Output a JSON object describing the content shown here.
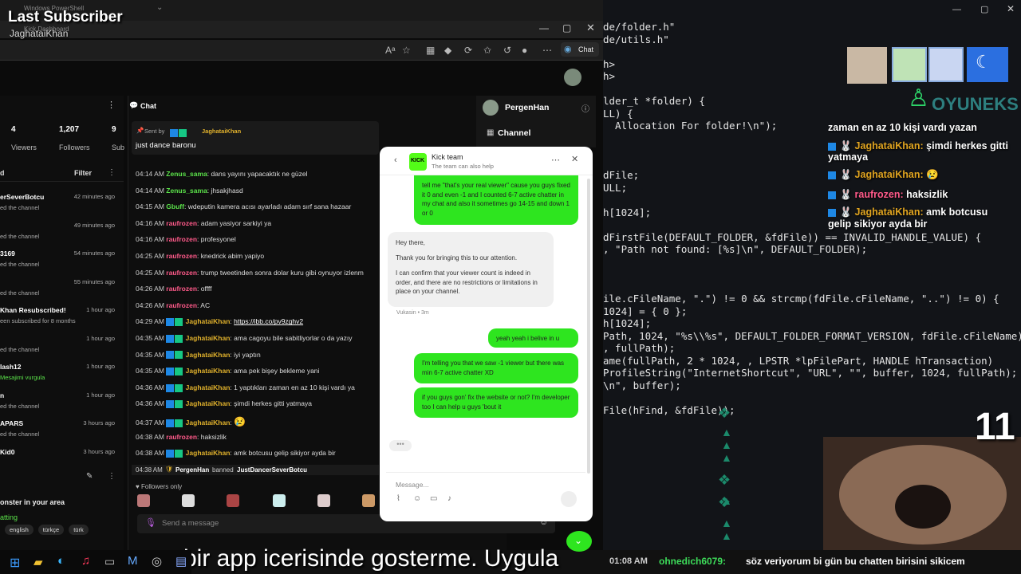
{
  "overlay_top": {
    "title": "Last Subscriber",
    "name": "JaghataiKhan"
  },
  "window_title": "Windows PowerShell",
  "tab_title": "Kick Dashboard",
  "browser": {
    "chat_button": "Chat"
  },
  "editor_lines": [
    "de/folder.h\"",
    "de/utils.h\"",
    "",
    "h>",
    "h>",
    "",
    "lder_t *folder) {",
    "LL) {",
    "  Allocation For folder!\\n\");",
    "",
    "",
    "",
    "dFile;",
    "ULL;",
    "",
    "h[1024];",
    "",
    "dFirstFile(DEFAULT_FOLDER, &fdFile)) == INVALID_HANDLE_VALUE) {",
    ", \"Path not found: [%s]\\n\", DEFAULT_FOLDER);",
    "",
    "",
    "",
    "ile.cFileName, \".\") != 0 && strcmp(fdFile.cFileName, \"..\") != 0) {",
    "1024] = { 0 };",
    "h[1024];",
    "Path, 1024, \"%s\\\\%s\", DEFAULT_FOLDER_FORMAT_VERSION, fdFile.cFileName);",
    ", fullPath);",
    "ame(fullPath, 2 * 1024, , LPSTR *lpFilePart, HANDLE hTransaction)",
    "ProfileString(\"InternetShortcut\", \"URL\", \"\", buffer, 1024, fullPath);",
    "\\n\", buffer);",
    "",
    "File(hFind, &fdFile));"
  ],
  "dashboard": {
    "stats": [
      {
        "value": "4",
        "label": "Viewers"
      },
      {
        "value": "1,207",
        "label": "Followers"
      },
      {
        "value": "9",
        "label": "Sub"
      }
    ],
    "chat_header": "Chat",
    "pinned": {
      "sent_by": "Sent by",
      "user": "JaghataiKhan",
      "message": "just dance baronu"
    },
    "filter_label": "Filter",
    "events": [
      {
        "name": "erSeverBotcu",
        "sub": "ed the channel",
        "time": "42 minutes ago"
      },
      {
        "name": "",
        "sub": "ed the channel",
        "time": "49 minutes ago"
      },
      {
        "name": "3169",
        "sub": "ed the channel",
        "time": "54 minutes ago"
      },
      {
        "name": "",
        "sub": "ed the channel",
        "time": "55 minutes ago"
      },
      {
        "name": "Khan Resubscribed!",
        "sub": "een subscribed for 8 months",
        "time": "1 hour ago"
      },
      {
        "name": "",
        "sub": "ed the channel",
        "time": "1 hour ago"
      },
      {
        "name": "lash12",
        "sub": "Mesajimi vurgula",
        "time": "1 hour ago"
      },
      {
        "name": "n",
        "sub": "ed the channel",
        "time": "1 hour ago"
      },
      {
        "name": "APARS",
        "sub": "ed the channel",
        "time": "3 hours ago"
      },
      {
        "name": "Kid0",
        "sub": "",
        "time": "3 hours ago"
      }
    ],
    "bottom_title": "onster in your area",
    "bottom_sub": "atting",
    "tags": [
      "english",
      "türkçe",
      "türk"
    ],
    "followers_only": "Followers only",
    "send_placeholder": "Send a message",
    "chat": [
      {
        "time": "04:14 AM",
        "user": "Zenus_sama",
        "msg": "dans yayını yapacaktık ne güzel",
        "style": "g"
      },
      {
        "time": "04:14 AM",
        "user": "Zenus_sama",
        "msg": "jhsakjhasd",
        "style": "g"
      },
      {
        "time": "04:15 AM",
        "user": "Gbuff",
        "msg": "wdeputin kamera acısı ayarladı adam sırf sana hazaar",
        "style": "g"
      },
      {
        "time": "04:16 AM",
        "user": "raufrozen",
        "msg": "adam yasiyor sarkiyi ya",
        "style": "r"
      },
      {
        "time": "04:16 AM",
        "user": "raufrozen",
        "msg": "profesyonel",
        "style": "r"
      },
      {
        "time": "04:25 AM",
        "user": "raufrozen",
        "msg": "knedrick abim yapiyo",
        "style": "r"
      },
      {
        "time": "04:25 AM",
        "user": "raufrozen",
        "msg": "trump tweetinden sonra dolar kuru gibi oynuyor izlenm",
        "style": "r"
      },
      {
        "time": "04:26 AM",
        "user": "raufrozen",
        "msg": "offff",
        "style": "r"
      },
      {
        "time": "04:26 AM",
        "user": "raufrozen",
        "msg": "AC",
        "style": "r"
      },
      {
        "time": "04:29 AM",
        "user": "JaghataiKhan",
        "msg": "https://ibb.co/pv9zghv2",
        "style": "y"
      },
      {
        "time": "04:35 AM",
        "user": "JaghataiKhan",
        "msg": "ama cagoyu bile sabitliyorlar o da yazıy",
        "style": "y"
      },
      {
        "time": "04:35 AM",
        "user": "JaghataiKhan",
        "msg": "iyi yaptın",
        "style": "y"
      },
      {
        "time": "04:35 AM",
        "user": "JaghataiKhan",
        "msg": "ama pek bişey bekleme yani",
        "style": "y"
      },
      {
        "time": "04:36 AM",
        "user": "JaghataiKhan",
        "msg": "1 yaptıkları zaman en az 10 kişi vardı ya",
        "style": "y"
      },
      {
        "time": "04:36 AM",
        "user": "JaghataiKhan",
        "msg": "şimdi herkes gitti yatmaya",
        "style": "y"
      },
      {
        "time": "04:37 AM",
        "user": "JaghataiKhan",
        "msg": "",
        "style": "y"
      },
      {
        "time": "04:38 AM",
        "user": "raufrozen",
        "msg": "haksizlik",
        "style": "r"
      },
      {
        "time": "04:38 AM",
        "user": "JaghataiKhan",
        "msg": "amk botcusu gelip sikiyor ayda bir",
        "style": "y"
      }
    ],
    "ban_line": {
      "time": "04:38 AM",
      "user": "PergenHan",
      "verb": "banned",
      "target": "JustDancerSeverBotcu"
    }
  },
  "side_menu": {
    "user": "PergenHan",
    "channel": "Channel"
  },
  "kick_modal": {
    "title": "Kick team",
    "subtitle": "The team can also help",
    "msg1": "tell me \"that's your real viewer\" cause you guys fixed it 0 and even -1 and I counted 6-7 active chatter in my chat and also it sometimes go 14-15 and down 1 or 0",
    "reply_p1": "Hey there,",
    "reply_p2": "Thank you for bringing this to our attention.",
    "reply_p3": "I can confirm that your viewer count is indeed in order, and there are no restrictions or limitations in place on your channel.",
    "reply_meta": "Vukasin • 3m",
    "msg2": "yeah yeah i belive in u",
    "msg3": "I'm telling you that we saw -1 viewer but there was min 6-7 active chatter XD",
    "msg4": "if you guys gon' fix the website or not? I'm developer too I can help u guys 'bout it",
    "placeholder": "Message..."
  },
  "overlay_chat": {
    "brand": "OYUNEKS",
    "lines": [
      {
        "user": "",
        "msg": "zaman en az 10 kişi vardı yazan"
      },
      {
        "user": "JaghataiKhan:",
        "msg": "şimdi herkes gitti"
      },
      {
        "user": "",
        "msg": "yatmaya"
      },
      {
        "user": "JaghataiKhan:",
        "msg": ""
      },
      {
        "user": "raufrozen:",
        "msg": "haksizlik"
      },
      {
        "user": "JaghataiKhan:",
        "msg": "amk botcusu"
      },
      {
        "user": "",
        "msg": "gelip sikiyor ayda bir"
      }
    ],
    "counter": "11",
    "ticker_time": "01:08 AM",
    "ticker_user": "ohnedich6079:",
    "ticker_msg": "söz veriyorum bi gün bu chatten birisini sikicem"
  },
  "subtitle": "bir app icerisinde gosterme. Uygula"
}
